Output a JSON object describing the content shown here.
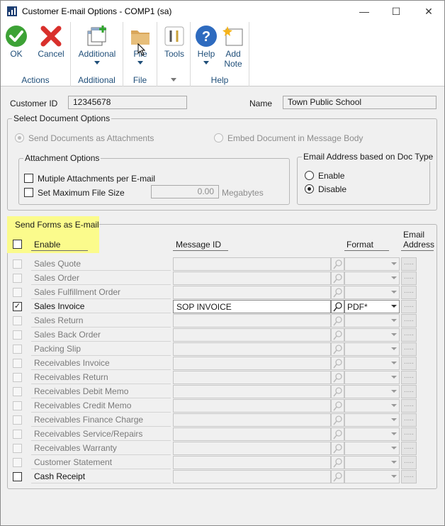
{
  "window": {
    "title": "Customer E-mail Options  -  COMP1 (sa)",
    "minimize": "—",
    "maximize": "☐",
    "close": "✕"
  },
  "ribbon": {
    "ok": "OK",
    "cancel": "Cancel",
    "actions_group": "Actions",
    "additional": "Additional",
    "additional_group": "Additional",
    "file": "File",
    "file_group": "File",
    "tools": "Tools",
    "help": "Help",
    "add_note_1": "Add",
    "add_note_2": "Note",
    "help_group": "Help"
  },
  "customer": {
    "id_label": "Customer ID",
    "id_value": "12345678",
    "name_label": "Name",
    "name_value": "Town Public School"
  },
  "select_document_options": {
    "title": "Select Document Options",
    "send_as_attachments": "Send Documents as Attachments",
    "embed_in_body": "Embed Document in Message Body"
  },
  "attachment_options": {
    "title": "Attachment Options",
    "multiple_attachments": "Mutiple Attachments per E-mail",
    "max_file_size": "Set Maximum File Size",
    "file_size_value": "0.00",
    "units": "Megabytes"
  },
  "email_address_by_doc_type": {
    "title": "Email Address based on Doc Type",
    "enable": "Enable",
    "disable": "Disable"
  },
  "send_forms": {
    "title": "Send Forms as E-mail",
    "enable_header": "Enable",
    "message_id_header": "Message ID",
    "format_header": "Format",
    "email_header_1": "Email",
    "email_header_2": "Address",
    "email_button": ".....",
    "rows": [
      {
        "label": "Sales Quote",
        "message_id": "",
        "format": ""
      },
      {
        "label": "Sales Order",
        "message_id": "",
        "format": ""
      },
      {
        "label": "Sales Fulfillment Order",
        "message_id": "",
        "format": ""
      },
      {
        "label": "Sales Invoice",
        "message_id": "SOP INVOICE",
        "format": "PDF*"
      },
      {
        "label": "Sales Return",
        "message_id": "",
        "format": ""
      },
      {
        "label": "Sales Back Order",
        "message_id": "",
        "format": ""
      },
      {
        "label": "Packing Slip",
        "message_id": "",
        "format": ""
      },
      {
        "label": "Receivables Invoice",
        "message_id": "",
        "format": ""
      },
      {
        "label": "Receivables Return",
        "message_id": "",
        "format": ""
      },
      {
        "label": "Receivables Debit Memo",
        "message_id": "",
        "format": ""
      },
      {
        "label": "Receivables Credit Memo",
        "message_id": "",
        "format": ""
      },
      {
        "label": "Receivables Finance Charge",
        "message_id": "",
        "format": ""
      },
      {
        "label": "Receivables Service/Repairs",
        "message_id": "",
        "format": ""
      },
      {
        "label": "Receivables Warranty",
        "message_id": "",
        "format": ""
      },
      {
        "label": "Customer Statement",
        "message_id": "",
        "format": ""
      },
      {
        "label": "Cash Receipt",
        "message_id": "",
        "format": ""
      }
    ]
  },
  "colors": {
    "highlight": "#fbfb8c",
    "ribbon_text": "#1f4e79"
  }
}
